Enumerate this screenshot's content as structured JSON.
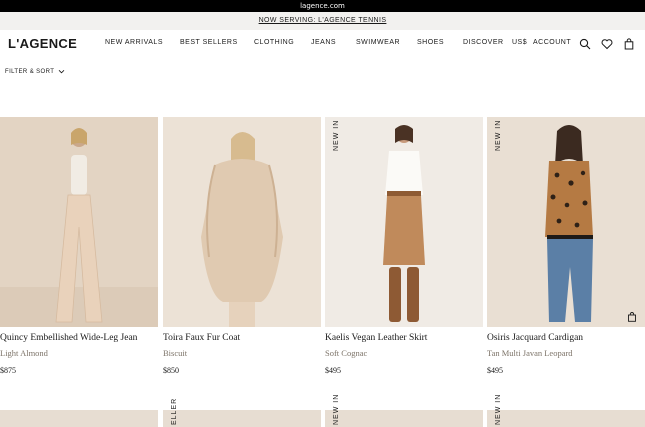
{
  "browser": {
    "url": "lagence.com"
  },
  "promo": {
    "text": "NOW SERVING: L'AGENCE TENNIS"
  },
  "header": {
    "logo": "L'AGENCE",
    "nav": [
      "NEW ARRIVALS",
      "BEST SELLERS",
      "CLOTHING",
      "JEANS",
      "SWIMWEAR",
      "SHOES",
      "DISCOVER",
      "US$"
    ],
    "account": "ACCOUNT"
  },
  "filter": {
    "label": "FILTER & SORT"
  },
  "products": [
    {
      "badge": "",
      "title": "Quincy Embellished Wide-Leg Jean",
      "color": "Light Almond",
      "price": "$875"
    },
    {
      "badge": "",
      "title": "Toira Faux Fur Coat",
      "color": "Biscuit",
      "price": "$850"
    },
    {
      "badge": "NEW IN",
      "title": "Kaelis Vegan Leather Skirt",
      "color": "Soft Cognac",
      "price": "$495"
    },
    {
      "badge": "NEW IN",
      "title": "Osiris Jacquard Cardigan",
      "color": "Tan Multi Javan Leopard",
      "price": "$495"
    }
  ],
  "row2_badges": [
    "",
    "ELLER",
    "NEW IN",
    "NEW IN"
  ]
}
